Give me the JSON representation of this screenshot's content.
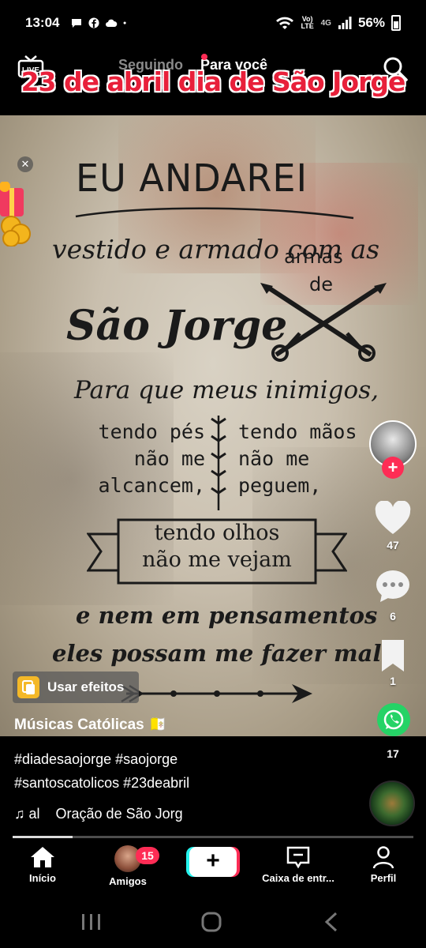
{
  "status_bar": {
    "time": "13:04",
    "left_icons": [
      "chat-bubble-icon",
      "facebook-icon",
      "cloud-icon",
      "dot-icon"
    ],
    "network_text": "Vo) LTE",
    "network_type": "4G",
    "battery": "56%"
  },
  "top_nav": {
    "live_label": "LIVE",
    "tab_following": "Seguindo",
    "tab_for_you": "Para você",
    "overlay_title": "23 de abril dia de São Jorge"
  },
  "poster": {
    "line1": "EU ANDAREI",
    "line2": "vestido e armado com as",
    "armas": "armas",
    "de": "de",
    "line3": "São Jorge",
    "line4": "Para que meus inimigos,",
    "left_col": [
      "tendo pés",
      "não me",
      "alcancem,"
    ],
    "right_col": [
      "tendo mãos",
      "não me",
      "peguem,"
    ],
    "banner_line1": "tendo olhos",
    "banner_line2": "não me vejam",
    "line5": "e nem em pensamentos",
    "line6": "eles possam me fazer mal..."
  },
  "right_rail": {
    "likes": "47",
    "comments": "6",
    "saves": "1",
    "shares": "17"
  },
  "effects_button": "Usar efeitos",
  "post": {
    "username": "Músicas Católicas 🇻🇦",
    "caption_line1": "#diadesaojorge #saojorge",
    "caption_line2": "#santoscatolicos #23deabril",
    "sound_prefix": "al",
    "sound_title": "Oração de São Jorg",
    "progress": 0.15
  },
  "bottom_nav": {
    "home": "Início",
    "friends": "Amigos",
    "friends_badge": "15",
    "create": "+",
    "inbox": "Caixa de entr...",
    "profile": "Perfil"
  },
  "colors": {
    "accent_red": "#fe2c55",
    "accent_cyan": "#25f4ee",
    "whatsapp": "#25d366",
    "title_red": "#e8203a"
  }
}
